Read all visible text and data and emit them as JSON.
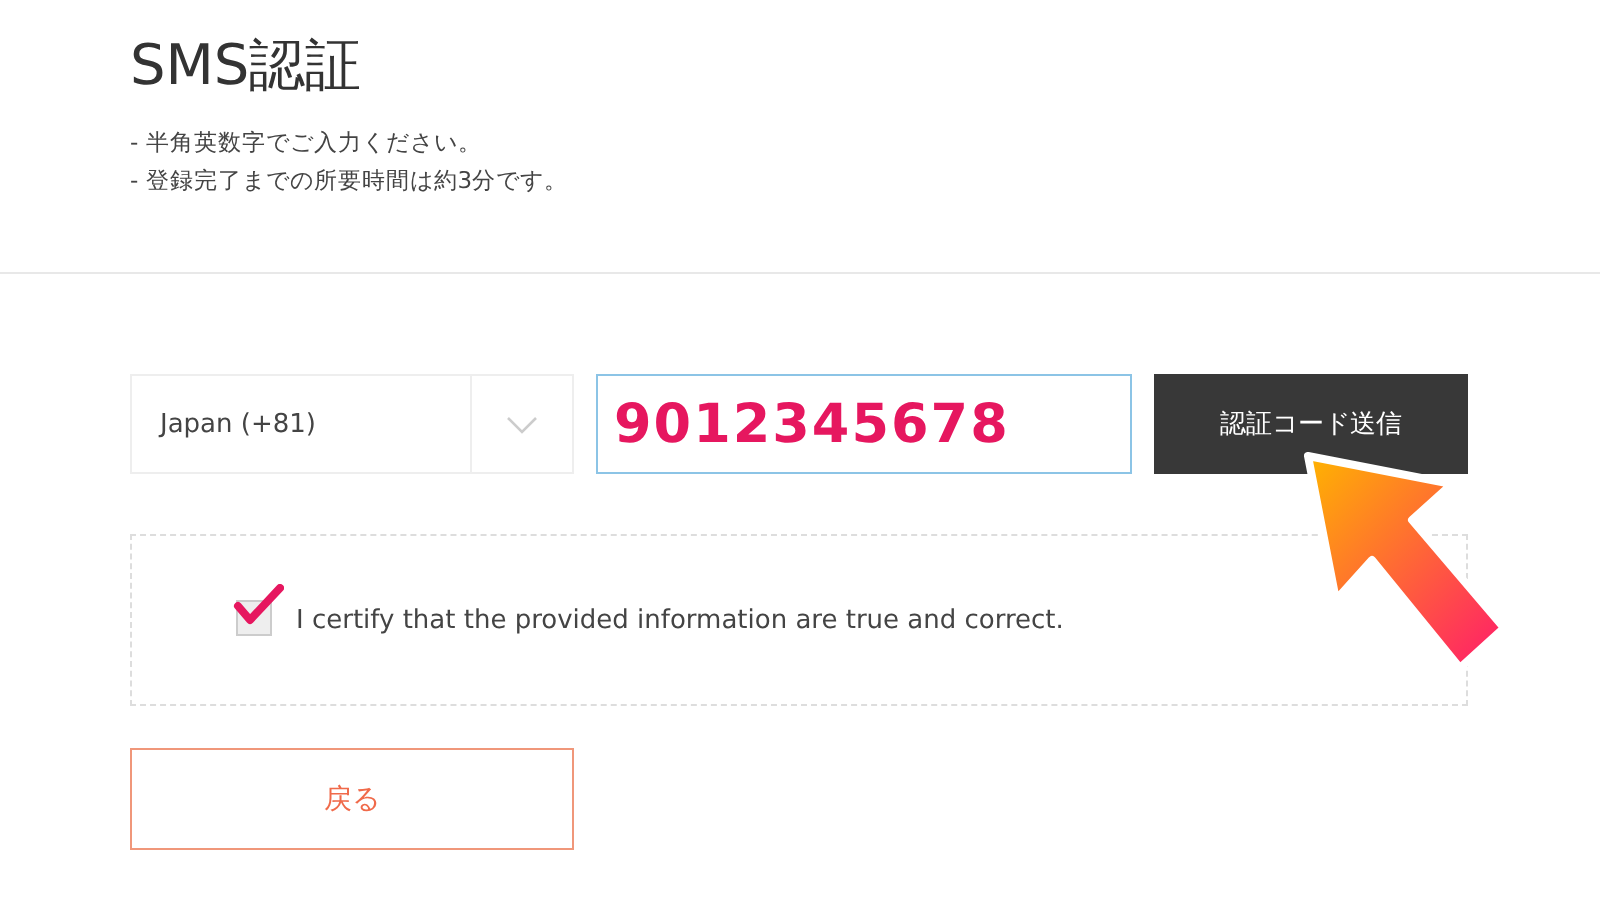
{
  "title": "SMS認証",
  "notes": [
    "- 半角英数字でご入力ください。",
    "- 登録完了までの所要時間は約3分です。"
  ],
  "country_select": {
    "value": "Japan (+81)"
  },
  "phone_field": {
    "value": "9012345678"
  },
  "send_button": {
    "label": "認証コード送信"
  },
  "certify": {
    "label": "I certify that the provided information are true and correct.",
    "checked": true
  },
  "back_button": {
    "label": "戻る"
  }
}
